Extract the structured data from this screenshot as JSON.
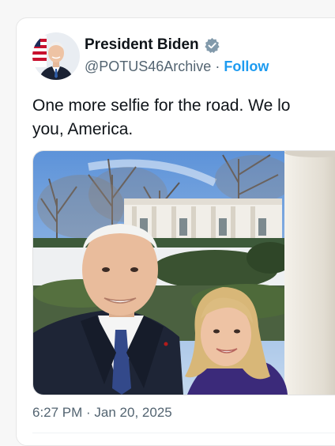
{
  "author": {
    "display_name": "President Biden",
    "handle": "@POTUS46Archive",
    "separator": "·",
    "follow_label": "Follow",
    "verified_icon": "verified-badge-icon",
    "accent_color": "#1d9bf0"
  },
  "tweet": {
    "text": "One more selfie for the road. We lo\nyou, America.",
    "timestamp": "6:27 PM · Jan 20, 2025"
  }
}
